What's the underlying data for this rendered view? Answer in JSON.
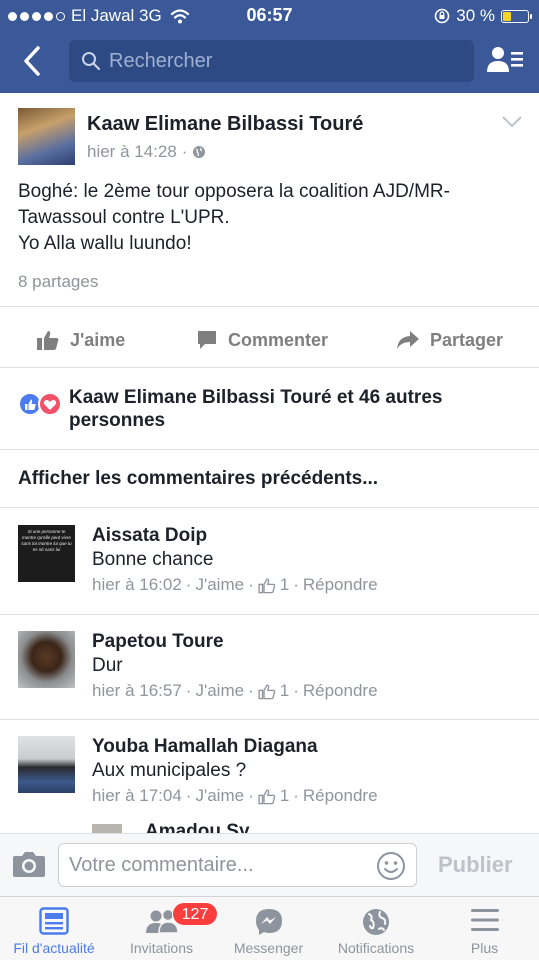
{
  "status_bar": {
    "carrier": "El Jawal 3G",
    "time": "06:57",
    "battery": "30 %",
    "battery_level": 0.3
  },
  "nav": {
    "search_placeholder": "Rechercher"
  },
  "post": {
    "author": "Kaaw Elimane Bilbassi Touré",
    "time": "hier à 14:28",
    "audience_icon": "globe-icon",
    "text_line1": "Boghé: le 2ème tour opposera la coalition AJD/MR-",
    "text_line2": "Tawassoul contre L'UPR.",
    "text_line3": "Yo Alla wallu luundo!",
    "shares": "8 partages",
    "actions": {
      "like": "J'aime",
      "comment": "Commenter",
      "share": "Partager"
    },
    "reactions_text": "Kaaw Elimane Bilbassi Touré et 46 autres personnes",
    "view_previous": "Afficher les commentaires précédents..."
  },
  "comments": [
    {
      "name": "Aissata Doip",
      "text": "Bonne chance",
      "time": "hier à 16:02",
      "like": "J'aime",
      "like_count": "1",
      "reply": "Répondre",
      "avatar_text": "Si une personne te montre qu'elle peut vivre sans toi montre lui que tu es né sans lui"
    },
    {
      "name": "Papetou Toure",
      "text": "Dur",
      "time": "hier à 16:57",
      "like": "J'aime",
      "like_count": "1",
      "reply": "Répondre"
    },
    {
      "name": "Youba Hamallah Diagana",
      "text": "Aux municipales ?",
      "time": "hier à 17:04",
      "like": "J'aime",
      "like_count": "1",
      "reply": "Répondre"
    }
  ],
  "partial_comment_name": "Amadou Sy",
  "composer": {
    "placeholder": "Votre commentaire...",
    "publish": "Publier"
  },
  "tabs": [
    {
      "label": "Fil d'actualité",
      "icon": "news-feed-icon",
      "active": true
    },
    {
      "label": "Invitations",
      "icon": "friend-requests-icon",
      "badge": "127"
    },
    {
      "label": "Messenger",
      "icon": "messenger-icon"
    },
    {
      "label": "Notifications",
      "icon": "globe-icon"
    },
    {
      "label": "Plus",
      "icon": "menu-icon"
    }
  ],
  "colors": {
    "brand": "#3b5998",
    "active_tab": "#4b7bec",
    "badge": "#fa3e3e",
    "like_reaction": "#4b7bec",
    "love_reaction": "#f25268"
  }
}
